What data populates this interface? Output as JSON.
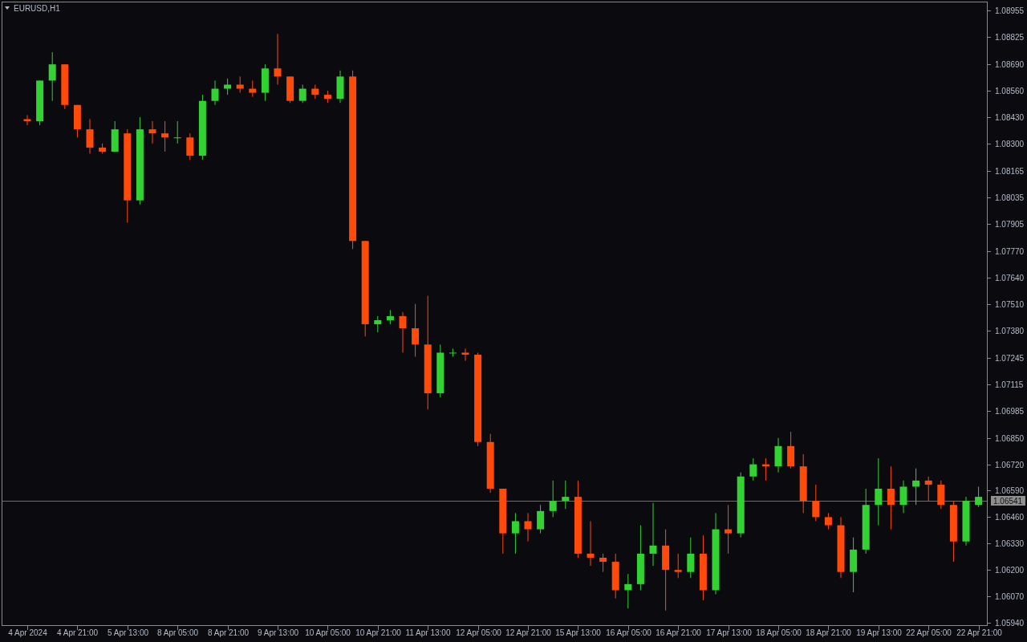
{
  "chart": {
    "symbol": "EURUSD,H1",
    "chart_data": {
      "type": "candlestick",
      "ylim": [
        1.05924,
        1.08995
      ],
      "yticks": [
        {
          "value": 1.08955,
          "label": "1.08955"
        },
        {
          "value": 1.08825,
          "label": "1.08825"
        },
        {
          "value": 1.0869,
          "label": "1.08690"
        },
        {
          "value": 1.0856,
          "label": "1.08560"
        },
        {
          "value": 1.0843,
          "label": "1.08430"
        },
        {
          "value": 1.083,
          "label": "1.08300"
        },
        {
          "value": 1.08165,
          "label": "1.08165"
        },
        {
          "value": 1.08035,
          "label": "1.08035"
        },
        {
          "value": 1.07905,
          "label": "1.07905"
        },
        {
          "value": 1.0777,
          "label": "1.07770"
        },
        {
          "value": 1.0764,
          "label": "1.07640"
        },
        {
          "value": 1.0751,
          "label": "1.07510"
        },
        {
          "value": 1.0738,
          "label": "1.07380"
        },
        {
          "value": 1.07245,
          "label": "1.07245"
        },
        {
          "value": 1.07115,
          "label": "1.07115"
        },
        {
          "value": 1.06985,
          "label": "1.06985"
        },
        {
          "value": 1.0685,
          "label": "1.06850"
        },
        {
          "value": 1.0672,
          "label": "1.06720"
        },
        {
          "value": 1.0659,
          "label": "1.06590"
        },
        {
          "value": 1.0646,
          "label": "1.06460"
        },
        {
          "value": 1.0633,
          "label": "1.06330"
        },
        {
          "value": 1.062,
          "label": "1.06200"
        },
        {
          "value": 1.0607,
          "label": "1.06070"
        },
        {
          "value": 1.0594,
          "label": "1.05940"
        }
      ],
      "categories": [
        "4 Apr 2024",
        null,
        null,
        null,
        "4 Apr 21:00",
        null,
        null,
        null,
        "5 Apr 13:00",
        null,
        null,
        null,
        "8 Apr 05:00",
        null,
        null,
        null,
        "8 Apr 21:00",
        null,
        null,
        null,
        "9 Apr 13:00",
        null,
        null,
        null,
        "10 Apr 05:00",
        null,
        null,
        null,
        "10 Apr 21:00",
        null,
        null,
        null,
        "11 Apr 13:00",
        null,
        null,
        null,
        "12 Apr 05:00",
        null,
        null,
        null,
        "12 Apr 21:00",
        null,
        null,
        null,
        "15 Apr 13:00",
        null,
        null,
        null,
        "16 Apr 05:00",
        null,
        null,
        null,
        "16 Apr 21:00",
        null,
        null,
        null,
        "17 Apr 13:00",
        null,
        null,
        null,
        "18 Apr 05:00",
        null,
        null,
        null,
        "18 Apr 21:00",
        null,
        null,
        null,
        "19 Apr 13:00",
        null,
        null,
        null,
        "22 Apr 05:00",
        null,
        null,
        null,
        "22 Apr 21:00"
      ],
      "ref_lines": [
        {
          "axis": "y",
          "value": 1.06541,
          "label": "1.06541"
        }
      ],
      "ohlc": [
        [
          1.0842,
          1.0844,
          1.0839,
          1.0841
        ],
        [
          1.0841,
          1.0861,
          1.0839,
          1.0861
        ],
        [
          1.0861,
          1.0875,
          1.0851,
          1.0869
        ],
        [
          1.0869,
          1.0869,
          1.0847,
          1.0849
        ],
        [
          1.0849,
          1.0849,
          1.0833,
          1.0837
        ],
        [
          1.0837,
          1.0842,
          1.0825,
          1.0828
        ],
        [
          1.0828,
          1.083,
          1.0825,
          1.0826
        ],
        [
          1.0826,
          1.0841,
          1.0826,
          1.0837
        ],
        [
          1.0835,
          1.0837,
          1.0791,
          1.0802
        ],
        [
          1.0802,
          1.0843,
          1.08,
          1.0837
        ],
        [
          1.0837,
          1.0841,
          1.083,
          1.0835
        ],
        [
          1.0835,
          1.0841,
          1.0826,
          1.0833
        ],
        [
          1.0833,
          1.0841,
          1.083,
          1.0833
        ],
        [
          1.0833,
          1.0835,
          1.0822,
          1.0824
        ],
        [
          1.0824,
          1.0854,
          1.0822,
          1.0851
        ],
        [
          1.0851,
          1.0861,
          1.0849,
          1.0857
        ],
        [
          1.0857,
          1.0862,
          1.0854,
          1.0859
        ],
        [
          1.0859,
          1.0863,
          1.0855,
          1.0857
        ],
        [
          1.0857,
          1.0861,
          1.0853,
          1.0855
        ],
        [
          1.0855,
          1.0869,
          1.0851,
          1.0867
        ],
        [
          1.0867,
          1.0884,
          1.0859,
          1.0863
        ],
        [
          1.0863,
          1.0863,
          1.085,
          1.0851
        ],
        [
          1.0851,
          1.0859,
          1.085,
          1.0857
        ],
        [
          1.0857,
          1.0859,
          1.0852,
          1.0854
        ],
        [
          1.0854,
          1.0856,
          1.085,
          1.0852
        ],
        [
          1.0852,
          1.0866,
          1.085,
          1.0863
        ],
        [
          1.0863,
          1.0866,
          1.0778,
          1.0782
        ],
        [
          1.0782,
          1.0782,
          1.0735,
          1.0741
        ],
        [
          1.0741,
          1.0745,
          1.0737,
          1.0743
        ],
        [
          1.0743,
          1.0748,
          1.0741,
          1.0745
        ],
        [
          1.0745,
          1.0747,
          1.0727,
          1.0739
        ],
        [
          1.0739,
          1.0751,
          1.0725,
          1.0731
        ],
        [
          1.0731,
          1.0755,
          1.0699,
          1.0707
        ],
        [
          1.0707,
          1.0731,
          1.0705,
          1.0727
        ],
        [
          1.0727,
          1.0729,
          1.0725,
          1.0727
        ],
        [
          1.0727,
          1.0729,
          1.0723,
          1.0726
        ],
        [
          1.0726,
          1.0727,
          1.0681,
          1.0683
        ],
        [
          1.0683,
          1.0687,
          1.0658,
          1.066
        ],
        [
          1.066,
          1.066,
          1.0628,
          1.0638
        ],
        [
          1.0638,
          1.0648,
          1.0628,
          1.0644
        ],
        [
          1.0644,
          1.0648,
          1.0634,
          1.064
        ],
        [
          1.064,
          1.0652,
          1.0638,
          1.0649
        ],
        [
          1.0649,
          1.0664,
          1.0646,
          1.0654
        ],
        [
          1.0654,
          1.0664,
          1.065,
          1.0656
        ],
        [
          1.0656,
          1.0664,
          1.0626,
          1.0628
        ],
        [
          1.0628,
          1.0644,
          1.0622,
          1.0626
        ],
        [
          1.0626,
          1.0628,
          1.0619,
          1.0624
        ],
        [
          1.0624,
          1.0628,
          1.0606,
          1.061
        ],
        [
          1.061,
          1.0618,
          1.0601,
          1.0613
        ],
        [
          1.0613,
          1.0642,
          1.061,
          1.0628
        ],
        [
          1.0628,
          1.0653,
          1.0622,
          1.0632
        ],
        [
          1.0632,
          1.064,
          1.06,
          1.062
        ],
        [
          1.062,
          1.0628,
          1.0616,
          1.0619
        ],
        [
          1.0619,
          1.0636,
          1.0616,
          1.0628
        ],
        [
          1.0628,
          1.0637,
          1.0605,
          1.061
        ],
        [
          1.061,
          1.0648,
          1.0608,
          1.064
        ],
        [
          1.064,
          1.0652,
          1.0628,
          1.0638
        ],
        [
          1.0638,
          1.0668,
          1.0636,
          1.0666
        ],
        [
          1.0666,
          1.0675,
          1.0664,
          1.0672
        ],
        [
          1.0672,
          1.0675,
          1.0664,
          1.0671
        ],
        [
          1.0671,
          1.0685,
          1.0668,
          1.0681
        ],
        [
          1.0681,
          1.0688,
          1.067,
          1.0671
        ],
        [
          1.0671,
          1.0677,
          1.0648,
          1.0654
        ],
        [
          1.0654,
          1.0662,
          1.0644,
          1.0646
        ],
        [
          1.0646,
          1.0648,
          1.064,
          1.0642
        ],
        [
          1.0642,
          1.0646,
          1.0616,
          1.0619
        ],
        [
          1.0619,
          1.0636,
          1.0609,
          1.063
        ],
        [
          1.063,
          1.066,
          1.0628,
          1.0652
        ],
        [
          1.0652,
          1.0675,
          1.0642,
          1.066
        ],
        [
          1.066,
          1.0671,
          1.064,
          1.0652
        ],
        [
          1.0652,
          1.0664,
          1.0648,
          1.0661
        ],
        [
          1.0661,
          1.067,
          1.0652,
          1.0664
        ],
        [
          1.0664,
          1.0666,
          1.0654,
          1.0662
        ],
        [
          1.0662,
          1.0664,
          1.065,
          1.0652
        ],
        [
          1.0652,
          1.0654,
          1.0624,
          1.0634
        ],
        [
          1.0634,
          1.0656,
          1.0632,
          1.0654
        ],
        [
          1.0652,
          1.0661,
          1.0651,
          1.0656
        ]
      ]
    }
  }
}
